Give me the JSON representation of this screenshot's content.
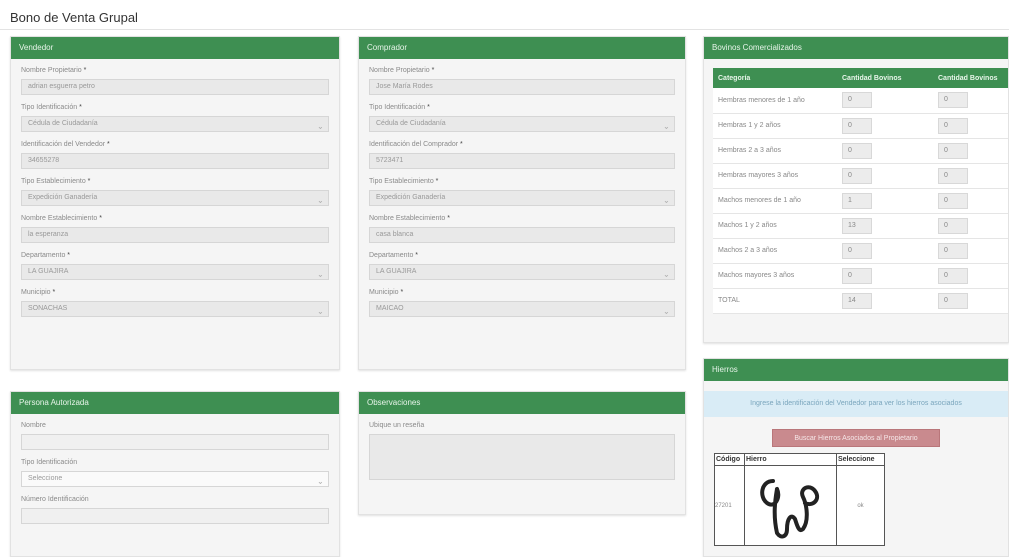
{
  "page": {
    "title": "Bono de Venta Grupal"
  },
  "vendedor": {
    "header": "Vendedor",
    "fields": [
      {
        "label": "Nombre Propietario",
        "value": "adrian esguerra petro",
        "type": "input"
      },
      {
        "label": "Tipo Identificación",
        "value": "Cédula de Ciudadanía",
        "type": "select"
      },
      {
        "label": "Identificación del Vendedor",
        "value": "34655278",
        "type": "input"
      },
      {
        "label": "Tipo Establecimiento",
        "value": "Expedición Ganadería",
        "type": "select"
      },
      {
        "label": "Nombre Establecimiento",
        "value": "la esperanza",
        "type": "input"
      },
      {
        "label": "Departamento",
        "value": "LA GUAJIRA",
        "type": "select"
      },
      {
        "label": "Municipio",
        "value": "SONACHAS",
        "type": "select"
      }
    ]
  },
  "comprador": {
    "header": "Comprador",
    "fields": [
      {
        "label": "Nombre Propietario",
        "value": "Jose María Rodes",
        "type": "input"
      },
      {
        "label": "Tipo Identificación",
        "value": "Cédula de Ciudadanía",
        "type": "select"
      },
      {
        "label": "Identificación del Comprador",
        "value": "5723471",
        "type": "input"
      },
      {
        "label": "Tipo Establecimiento",
        "value": "Expedición Ganadería",
        "type": "select"
      },
      {
        "label": "Nombre Establecimiento",
        "value": "casa blanca",
        "type": "input"
      },
      {
        "label": "Departamento",
        "value": "LA GUAJIRA",
        "type": "select"
      },
      {
        "label": "Municipio",
        "value": "MAICAO",
        "type": "select"
      }
    ]
  },
  "persona": {
    "header": "Persona Autorizada",
    "fields": [
      {
        "label": "Nombre",
        "value": "",
        "type": "input"
      },
      {
        "label": "Tipo Identificación",
        "value": "Seleccione",
        "type": "select"
      },
      {
        "label": "Número Identificación",
        "value": "",
        "type": "input"
      }
    ]
  },
  "observaciones": {
    "header": "Observaciones",
    "label": "Ubique un reseña",
    "value": ""
  },
  "bovinos": {
    "header": "Bovinos Comercializados",
    "columns": [
      "Categoría",
      "Cantidad Bovinos",
      "Cantidad Bovinos"
    ],
    "rows": [
      {
        "categoria": "Hembras menores de 1 año",
        "c1": "0",
        "c2": "0"
      },
      {
        "categoria": "Hembras 1 y 2 años",
        "c1": "0",
        "c2": "0"
      },
      {
        "categoria": "Hembras 2 a 3 años",
        "c1": "0",
        "c2": "0"
      },
      {
        "categoria": "Hembras mayores 3 años",
        "c1": "0",
        "c2": "0"
      },
      {
        "categoria": "Machos menores de 1 año",
        "c1": "1",
        "c2": "0"
      },
      {
        "categoria": "Machos 1 y 2 años",
        "c1": "13",
        "c2": "0"
      },
      {
        "categoria": "Machos 2 a 3 años",
        "c1": "0",
        "c2": "0"
      },
      {
        "categoria": "Machos mayores 3 años",
        "c1": "0",
        "c2": "0"
      },
      {
        "categoria": "TOTAL",
        "c1": "14",
        "c2": "0"
      }
    ]
  },
  "hierros": {
    "header": "Hierros",
    "info": "Ingrese la identificación del Vendedor para ver los hierros asociados",
    "button": "Buscar Hierros Asociados al Propietario",
    "columns": [
      "Código",
      "Hierro",
      "Seleccione"
    ],
    "row": {
      "codigo": "27201",
      "seleccione": "ok"
    }
  }
}
